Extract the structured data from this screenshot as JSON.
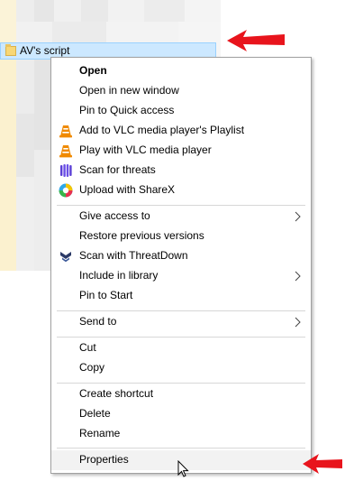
{
  "folder": {
    "name": "AV's script"
  },
  "menu": {
    "group1": [
      {
        "label": "Open",
        "bold": true
      },
      {
        "label": "Open in new window"
      },
      {
        "label": "Pin to Quick access"
      },
      {
        "label": "Add to VLC media player's Playlist",
        "icon": "vlc-icon"
      },
      {
        "label": "Play with VLC media player",
        "icon": "vlc-icon"
      },
      {
        "label": "Scan for threats",
        "icon": "malwarebytes-icon"
      },
      {
        "label": "Upload with ShareX",
        "icon": "sharex-icon"
      }
    ],
    "group2": [
      {
        "label": "Give access to",
        "submenu": true
      },
      {
        "label": "Restore previous versions"
      },
      {
        "label": "Scan with ThreatDown",
        "icon": "threatdown-icon"
      },
      {
        "label": "Include in library",
        "submenu": true
      },
      {
        "label": "Pin to Start"
      }
    ],
    "group3": [
      {
        "label": "Send to",
        "submenu": true
      }
    ],
    "group4": [
      {
        "label": "Cut"
      },
      {
        "label": "Copy"
      }
    ],
    "group5": [
      {
        "label": "Create shortcut"
      },
      {
        "label": "Delete"
      },
      {
        "label": "Rename"
      }
    ],
    "group6": [
      {
        "label": "Properties"
      }
    ]
  },
  "colors": {
    "selection": "#cce8ff",
    "arrow": "#e8141c",
    "vlc": "#f08a00",
    "malwarebytes": "#5b3fd6",
    "threatdown": "#2b3a67"
  }
}
